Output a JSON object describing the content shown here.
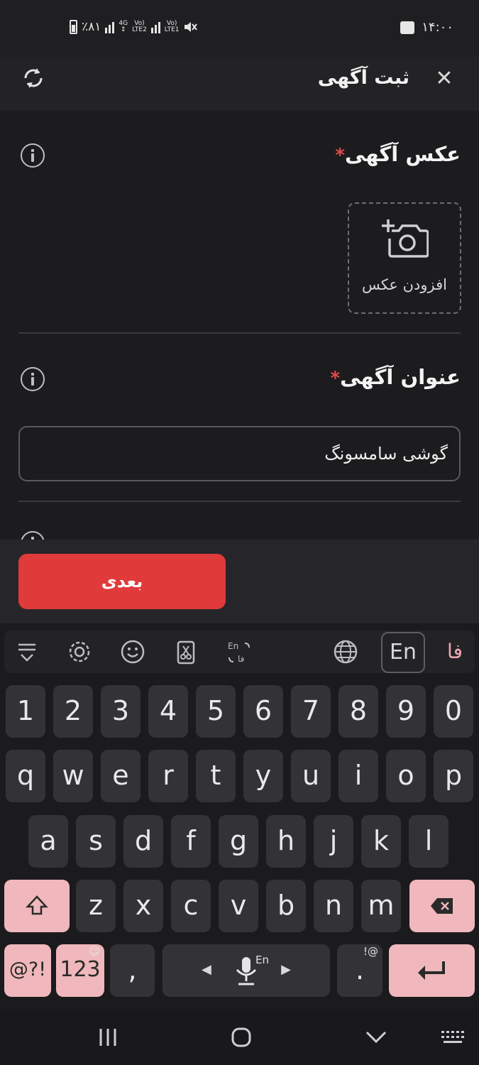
{
  "status_bar": {
    "battery": "٪۸۱",
    "net1": "4G",
    "lte2": "LTE2",
    "lte1": "LTE1",
    "volte": "Vo)",
    "time": "۱۴:۰۰"
  },
  "app_bar": {
    "title": "ثبت آگهی",
    "close_icon": "close-icon",
    "refresh_icon": "refresh-icon"
  },
  "photo_section": {
    "label": "عکس آگهی",
    "required_mark": "*",
    "add_photo_label": "افزودن عکس"
  },
  "title_section": {
    "label": "عنوان آگهی",
    "required_mark": "*",
    "value": "گوشی سامسونگ"
  },
  "action": {
    "next_label": "بعدی"
  },
  "keyboard": {
    "toolbar": {
      "lang_en": "En",
      "lang_fa": "فا"
    },
    "numbers": [
      "1",
      "2",
      "3",
      "4",
      "5",
      "6",
      "7",
      "8",
      "9",
      "0"
    ],
    "row_q": [
      "q",
      "w",
      "e",
      "r",
      "t",
      "y",
      "u",
      "i",
      "o",
      "p"
    ],
    "row_a": [
      "a",
      "s",
      "d",
      "f",
      "g",
      "h",
      "j",
      "k",
      "l"
    ],
    "row_z": [
      "z",
      "x",
      "c",
      "v",
      "b",
      "n",
      "m"
    ],
    "sym_key": "@?!",
    "num_key": "123",
    "comma_key": ",",
    "period_key": ".",
    "period_sup": "!@",
    "space_lang": "En"
  },
  "colors": {
    "accent_red": "#e03a3a",
    "key_pink": "#f0b8bc",
    "required_red": "#e24a4a"
  }
}
